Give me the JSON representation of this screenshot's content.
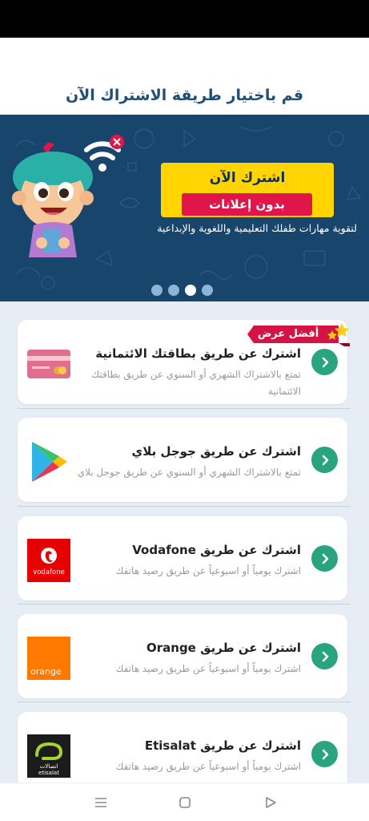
{
  "page": {
    "title": "قم باختيار طريقة الاشتراك الآن"
  },
  "banner": {
    "cta_title": "اشترك الآن",
    "cta_subtitle": "بدون إعلانات",
    "tagline": "لتقوية مهارات طفلك التعليمية واللغوية والإبداعية",
    "slides_total": 4,
    "active_slide": 3
  },
  "best_offer": {
    "label": "أفضل عرض"
  },
  "options": [
    {
      "title": "اشترك عن طريق بطاقتك الائتمانية",
      "description": "تمتع بالاشتراك الشهري أو السنوي عن طريق بطاقتك الائتمانية",
      "icon": "credit-card-icon"
    },
    {
      "title": "اشترك عن طريق جوجل بلاي",
      "description": "تمتع بالاشتراك الشهري أو السنوي عن طريق جوجل بلاي",
      "icon": "google-play-icon"
    },
    {
      "title": "اشترك عن طريق Vodafone",
      "description": "اشترك يومياً أو اسبوعياً عن طريق رصيد هاتفك",
      "icon": "vodafone-logo",
      "logo_text": "vodafone"
    },
    {
      "title": "اشترك عن طريق Orange",
      "description": "اشترك يومياً أو اسبوعياً عن طريق رصيد هاتفك",
      "icon": "orange-logo",
      "logo_text": "orange"
    },
    {
      "title": "اشترك عن طريق Etisalat",
      "description": "اشترك يومياً أو اسبوعياً عن طريق رصيد هاتفك",
      "icon": "etisalat-logo",
      "logo_text": "etisalat",
      "logo_text_ar": "اتصالات"
    }
  ],
  "colors": {
    "title": "#1f4e79",
    "banner_bg": "#18456b",
    "cta_yellow": "#ffd400",
    "cta_red": "#e0164a",
    "arrow_green": "#2aa37f",
    "badge_red": "#d41444",
    "list_bg": "#e6edf5"
  },
  "nav": {
    "items": [
      "menu-icon",
      "home-icon",
      "back-icon"
    ]
  }
}
